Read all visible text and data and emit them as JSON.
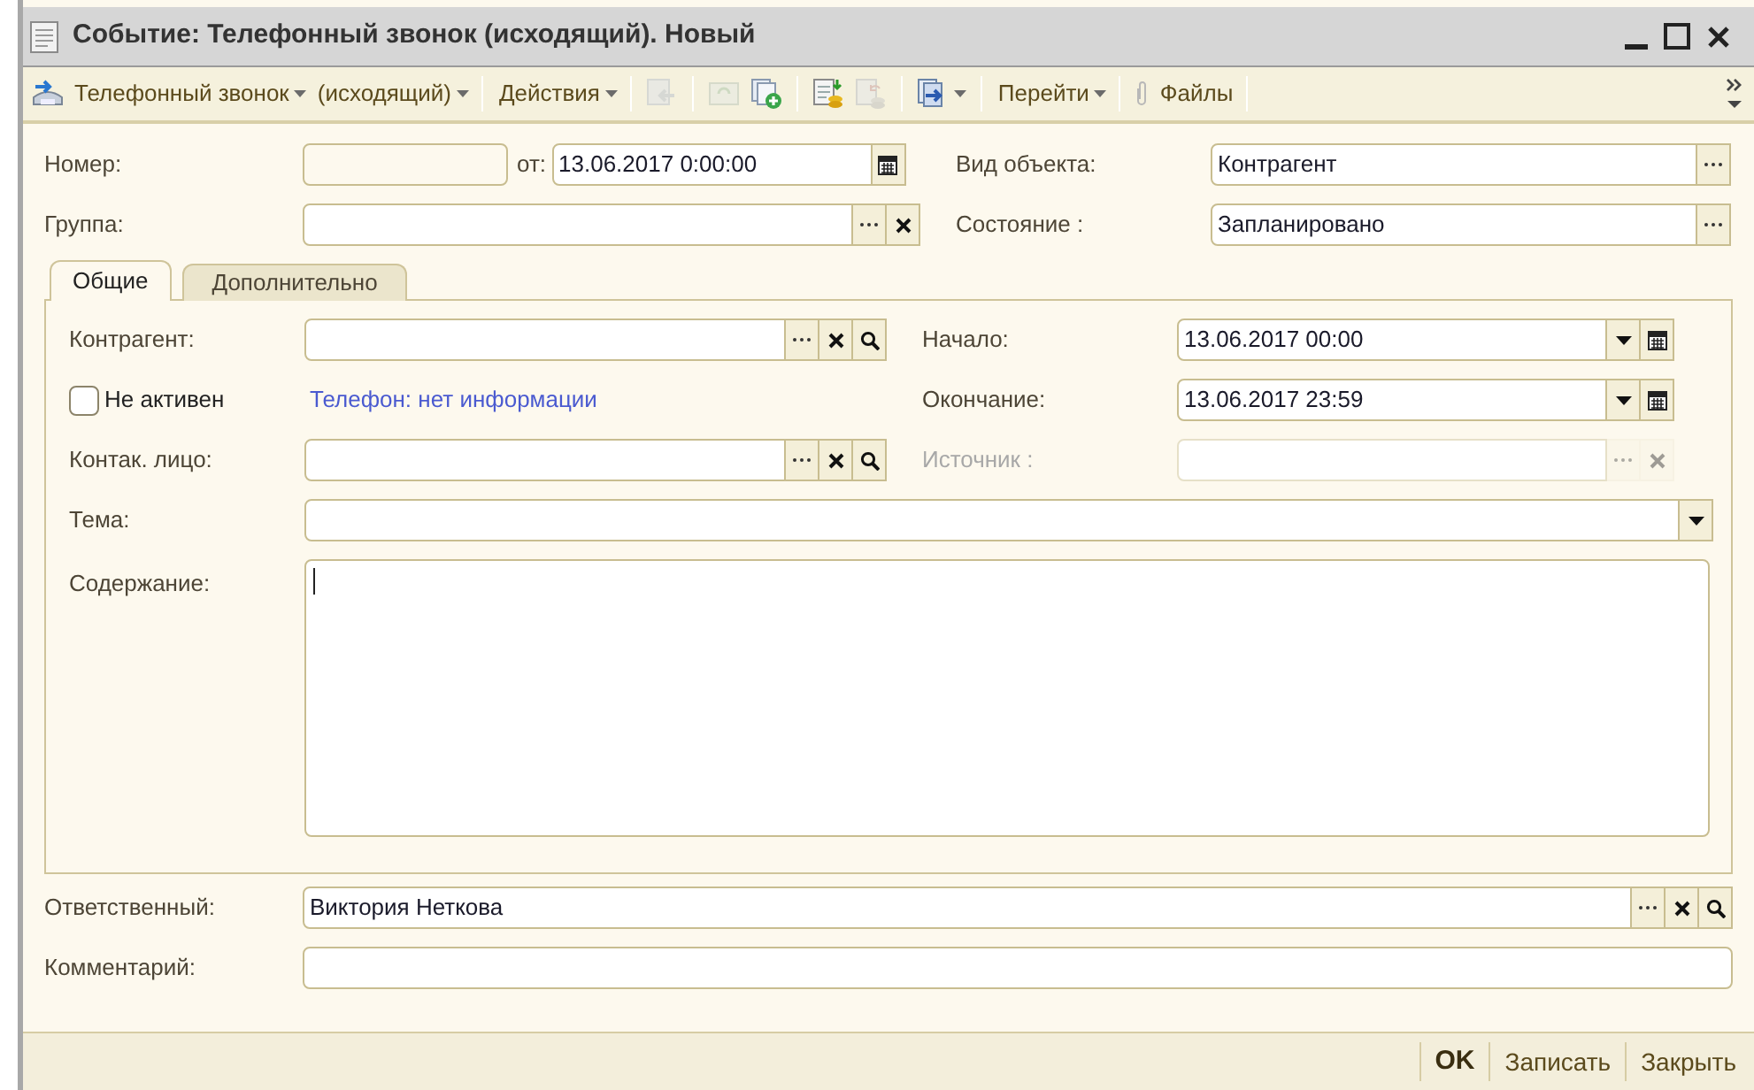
{
  "window": {
    "title": "Событие: Телефонный звонок (исходящий). Новый"
  },
  "toolbar": [
    {
      "kind": "menu",
      "label": "Телефонный звонок"
    },
    {
      "kind": "menu",
      "label": "(исходящий)"
    },
    {
      "kind": "separator"
    },
    {
      "kind": "menu",
      "label": "Действия"
    },
    {
      "kind": "separator"
    },
    {
      "kind": "icon",
      "disabled": true
    },
    {
      "kind": "separator"
    },
    {
      "kind": "icon",
      "disabled": true
    },
    {
      "kind": "icon",
      "disabled": false
    },
    {
      "kind": "separator"
    },
    {
      "kind": "icon",
      "disabled": false
    },
    {
      "kind": "icon",
      "disabled": true
    },
    {
      "kind": "separator"
    },
    {
      "kind": "icon_menu",
      "disabled": false
    },
    {
      "kind": "separator"
    },
    {
      "kind": "menu",
      "label": "Перейти"
    },
    {
      "kind": "separator"
    },
    {
      "kind": "button",
      "label": "Файлы"
    },
    {
      "kind": "separator"
    },
    {
      "kind": "overflow"
    }
  ],
  "header": {
    "number": {
      "label": "Номер:"
    },
    "date": {
      "label": "от:",
      "value": "13.06.2017  0:00:00"
    },
    "group": {
      "label": "Группа:"
    },
    "object_type": {
      "label": "Вид объекта:",
      "value": "Контрагент"
    },
    "state": {
      "label": "Состояние :",
      "value": "Запланировано"
    }
  },
  "tabs": [
    {
      "label": "Общие",
      "selected": true
    },
    {
      "label": "Дополнительно",
      "selected": false
    }
  ],
  "general": {
    "counterparty": {
      "label": "Контрагент:"
    },
    "inactive": {
      "label": "Не активен",
      "checked": false
    },
    "phone_link": "Телефон: нет информации",
    "contact": {
      "label": "Контак. лицо:"
    },
    "start": {
      "label": "Начало:",
      "value": "13.06.2017 00:00"
    },
    "end": {
      "label": "Окончание:",
      "value": "13.06.2017 23:59"
    },
    "source": {
      "label": "Источник :",
      "disabled": true
    },
    "topic": {
      "label": "Тема:"
    },
    "content": {
      "label": "Содержание:"
    }
  },
  "responsible": {
    "label": "Ответственный:",
    "value": "Виктория Неткова"
  },
  "comment": {
    "label": "Комментарий:"
  },
  "footer_buttons": [
    {
      "label": "OK",
      "default": true
    },
    {
      "label": "Записать",
      "default": false
    },
    {
      "label": "Закрыть",
      "default": false
    }
  ]
}
